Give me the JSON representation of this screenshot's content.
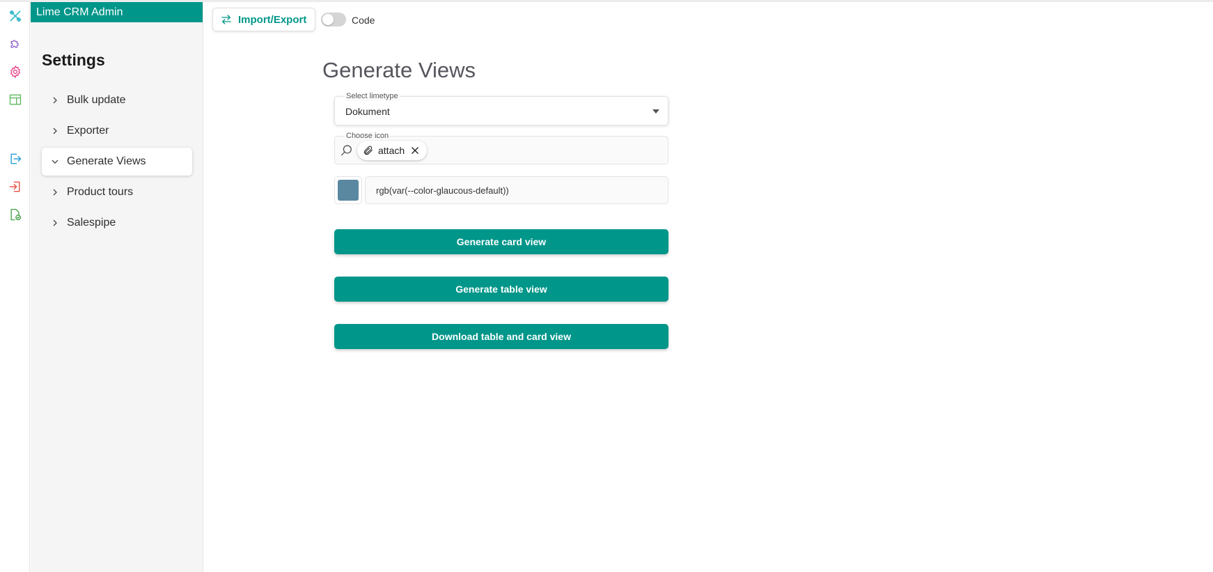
{
  "app": {
    "brand": "Lime CRM Admin"
  },
  "rail": {
    "icons": [
      {
        "name": "tools-icon",
        "color": "#29b6c6"
      },
      {
        "name": "puzzle-icon",
        "color": "#8e5fd0"
      },
      {
        "name": "gear-icon",
        "color": "#e8498a"
      },
      {
        "name": "layout-icon",
        "color": "#5cb85c"
      },
      {
        "name": "export-icon",
        "color": "#2a9fd6"
      },
      {
        "name": "import-icon",
        "color": "#e8544a"
      },
      {
        "name": "document-check-icon",
        "color": "#43a047"
      }
    ]
  },
  "settings": {
    "title": "Settings",
    "items": [
      {
        "label": "Bulk update",
        "expanded": false
      },
      {
        "label": "Exporter",
        "expanded": false
      },
      {
        "label": "Generate Views",
        "expanded": true
      },
      {
        "label": "Product tours",
        "expanded": false
      },
      {
        "label": "Salespipe",
        "expanded": false
      }
    ]
  },
  "toolbar": {
    "import_export_label": "Import/Export",
    "code_toggle_label": "Code",
    "code_toggle_on": false
  },
  "main": {
    "title": "Generate Views",
    "limetype": {
      "label": "Select limetype",
      "value": "Dokument"
    },
    "icon_picker": {
      "label": "Choose icon",
      "chip_label": "attach",
      "chip_icon": "paperclip-icon"
    },
    "color": {
      "swatch": "#5a88a0",
      "value": "rgb(var(--color-glaucous-default))"
    },
    "buttons": {
      "card": "Generate card view",
      "table": "Generate table view",
      "download": "Download table and card view"
    },
    "accent": "#00968a"
  }
}
